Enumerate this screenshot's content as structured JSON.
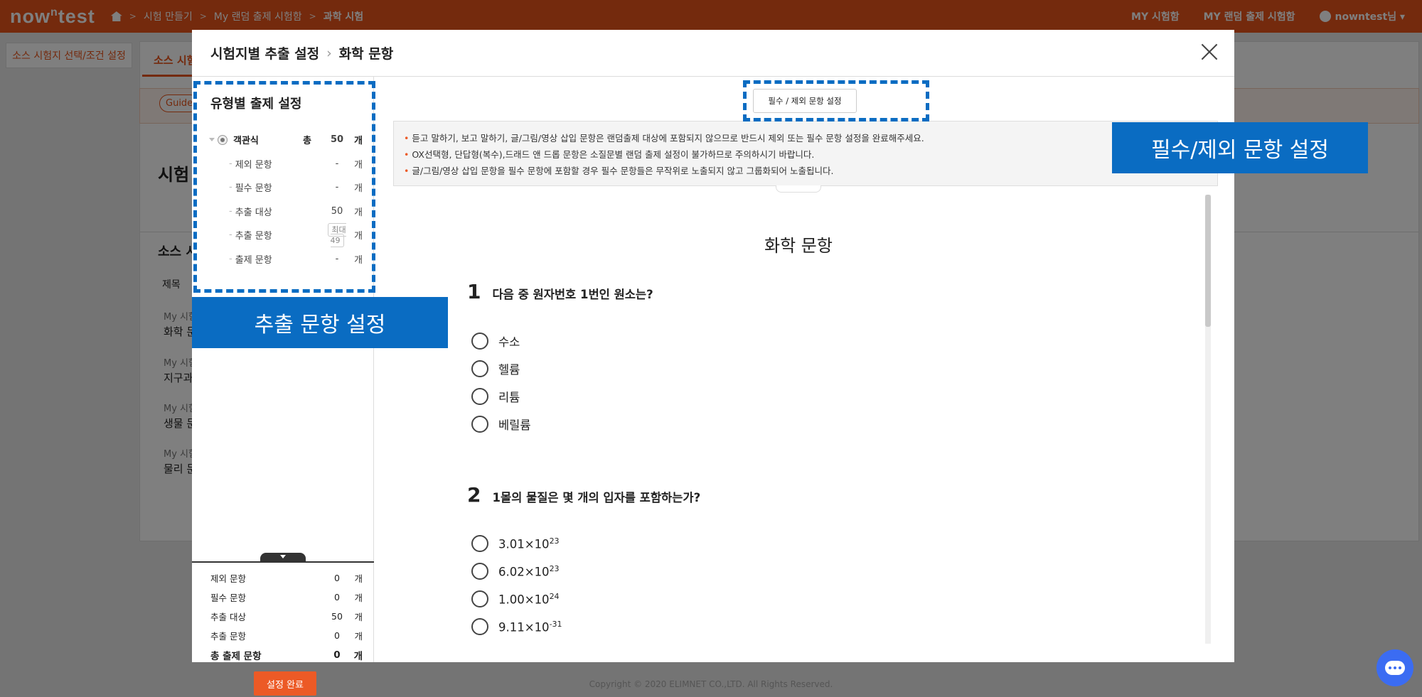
{
  "topbar": {
    "logo": "nowntest",
    "breadcrumb": [
      "시험 만들기",
      "My 랜덤 출제 시험함",
      "과학 시험"
    ],
    "links": [
      "MY 시험함",
      "MY 랜덤 출제 시험함"
    ],
    "user": "nowntest님"
  },
  "background": {
    "left_tab": "소스 시험지 선택/조건 설정",
    "tab": "소스 시험",
    "guide": "Guide",
    "page_title": "시험",
    "source_title": "소스 시",
    "table_header": "제목",
    "rows": [
      {
        "a": "My 시험",
        "b": "화학 문"
      },
      {
        "a": "My 시험",
        "b": "지구과"
      },
      {
        "a": "My 시험",
        "b": "생물 문"
      },
      {
        "a": "My 시험",
        "b": "물리 문"
      }
    ],
    "footer": "Copyright © 2020 ELIMNET CO.,LTD. All Rights Reserved."
  },
  "modal": {
    "title": "시험지별 추출 설정",
    "subtitle": "화학 문항",
    "left": {
      "title": "유형별 출제 설정",
      "root": {
        "label": "객관식",
        "total_label": "총",
        "total": "50",
        "unit": "개"
      },
      "children": [
        {
          "label": "제외 문항",
          "value": "-",
          "unit": "개"
        },
        {
          "label": "필수 문항",
          "value": "-",
          "unit": "개"
        },
        {
          "label": "추출 대상",
          "value": "50",
          "unit": "개"
        },
        {
          "label": "추출 문항",
          "value": "최대 49",
          "unit": "개"
        },
        {
          "label": "출제 문항",
          "value": "-",
          "unit": "개"
        }
      ],
      "summary": [
        {
          "label": "제외 문항",
          "value": "0",
          "unit": "개"
        },
        {
          "label": "필수 문항",
          "value": "0",
          "unit": "개"
        },
        {
          "label": "추출 대상",
          "value": "50",
          "unit": "개"
        },
        {
          "label": "추출 문항",
          "value": "0",
          "unit": "개"
        },
        {
          "label": "총 출제 문항",
          "value": "0",
          "unit": "개"
        }
      ],
      "done_button": "설정 완료"
    },
    "right": {
      "required_button": "필수 / 제외 문항 설정",
      "notices": [
        "듣고 말하기, 보고 말하기, 글/그림/영상 삽입 문항은 랜덤출제 대상에 포함되지 않으므로 반드시 제외 또는 필수 문항 설정을 완료해주세요.",
        "OX선택형, 단답형(복수),드래드 앤 드롭 문항은 소질문별 랜덤 출제 설정이 불가하므로 주의하시기 바랍니다.",
        "글/그림/영상 삽입 문항을 필수 문항에 포함할 경우 필수 문항들은 무작위로 노출되지 않고 그룹화되어 노출됩니다."
      ],
      "doc_title": "화학 문항",
      "questions": [
        {
          "number": "1",
          "text": "다음 중 원자번호 1번인 원소는?",
          "options": [
            "수소",
            "헬륨",
            "리튬",
            "베릴륨"
          ]
        },
        {
          "number": "2",
          "text": "1몰의 물질은 몇 개의 입자를 포함하는가?",
          "options": [
            {
              "base": "3.01×10",
              "exp": "23"
            },
            {
              "base": "6.02×10",
              "exp": "23"
            },
            {
              "base": "1.00×10",
              "exp": "24"
            },
            {
              "base": "9.11×10",
              "exp": "-31"
            }
          ]
        }
      ]
    }
  },
  "annotations": {
    "left": "추출 문항 설정",
    "right": "필수/제외 문항 설정",
    "color": "#0a6cc2"
  },
  "colors": {
    "brand": "#e8541b",
    "accent_button": "#ec5a26"
  }
}
